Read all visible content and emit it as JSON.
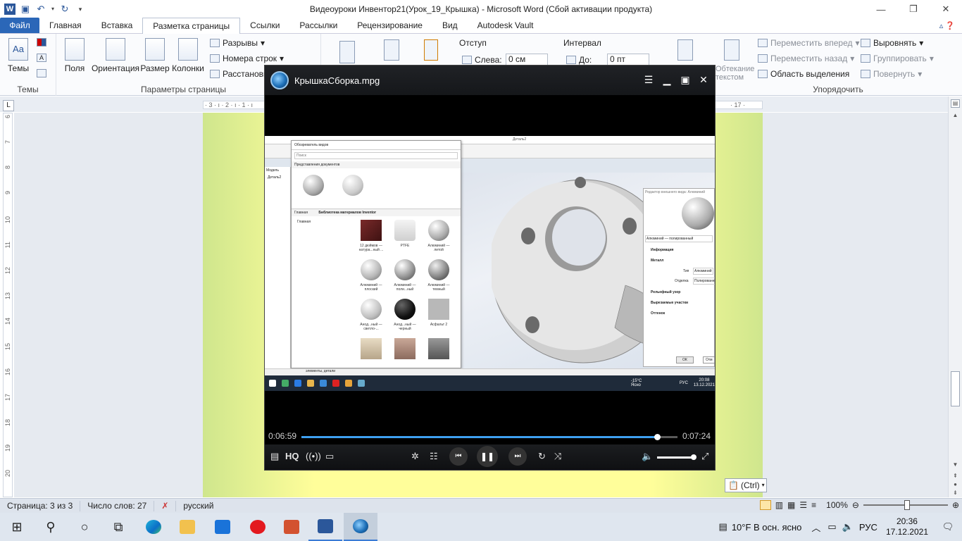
{
  "window": {
    "title": "Видеоуроки Инвентор21(Урок_19_Крышка)  -  Microsoft Word (Сбой активации продукта)"
  },
  "tabs": [
    {
      "label": "Файл"
    },
    {
      "label": "Главная"
    },
    {
      "label": "Вставка"
    },
    {
      "label": "Разметка страницы"
    },
    {
      "label": "Ссылки"
    },
    {
      "label": "Рассылки"
    },
    {
      "label": "Рецензирование"
    },
    {
      "label": "Вид"
    },
    {
      "label": "Autodesk Vault"
    }
  ],
  "ribbon": {
    "themes": {
      "big": "Темы",
      "group": "Темы"
    },
    "page_setup": {
      "fields": "Поля",
      "orientation": "Ориентация",
      "size": "Размер",
      "columns": "Колонки",
      "breaks": "Разрывы",
      "line_numbers": "Номера строк",
      "hyphenation": "Расстановк",
      "group": "Параметры страницы"
    },
    "indent": {
      "label": "Отступ",
      "left_label": "Слева:",
      "left_value": "0 см"
    },
    "spacing": {
      "label": "Интервал",
      "after_label": "До:",
      "after_value": "0 пт"
    },
    "wrap_label_1": "Обтекание",
    "wrap_label_2": "текстом",
    "arrange": {
      "bring_forward": "Переместить вперед",
      "send_backward": "Переместить назад",
      "selection_pane": "Область выделения",
      "align": "Выровнять",
      "group_btn": "Группировать",
      "rotate": "Повернуть",
      "group": "Упорядочить"
    }
  },
  "ruler": {
    "top_left": "· 3 · ı · 2 · ı · 1 · ı",
    "top_right": "· 17 ·",
    "left_numbers": [
      "6",
      "7",
      "8",
      "9",
      "10",
      "11",
      "12",
      "13",
      "14",
      "15",
      "16",
      "17",
      "18",
      "19",
      "20"
    ]
  },
  "player": {
    "title": "КрышкаСборка.mpg",
    "time_current": "0:06:59",
    "time_total": "0:07:24",
    "progress": 0.945,
    "hq_label": "HQ"
  },
  "video_content": {
    "browser_title": "Обозреватель видов",
    "search": "Поиск",
    "doc_views": "Представления документов",
    "main_tab": "Главная",
    "library": "Библиотека материалов Inventor",
    "tree_root": "Главная",
    "materials": [
      "12 дюймов — натура...ный ...",
      "PTFE",
      "Алюминий — литой",
      "Алюминий — плоский",
      "Алюминий — поли...ный",
      "Алюминий — темный",
      "Анод...ный — светло-...",
      "Анод...ный — черный",
      "Асфальт 2"
    ],
    "panel_title": "Редактор внешнего вида: Алюминий",
    "panel_material": "Алюминий — полированный",
    "panel_info": "Информация",
    "panel_metal": "Металл",
    "panel_type_label": "Тип",
    "panel_type_value": "Алюминий",
    "panel_finish_label": "Отделка",
    "panel_finish_value": "Полированный",
    "panel_relief": "Рельефный узор",
    "panel_cutout": "Вырезаемые участки",
    "panel_tint": "Оттенок",
    "panel_ok": "ОК",
    "panel_cancel": "Отм",
    "inner_status": "элементы, детали",
    "inner_weather": "-15°C  Ясно",
    "inner_lang": "РУС",
    "inner_time": "20:08",
    "inner_date": "13.12.2021",
    "model_tab": "Модель",
    "detail_label": "Деталь2"
  },
  "paste_tag": "(Ctrl)",
  "statusbar": {
    "page": "Страница: 3 из 3",
    "words": "Число слов: 27",
    "language": "русский",
    "zoom": "100%"
  },
  "taskbar": {
    "weather": "10°F  В осн. ясно",
    "lang": "РУС",
    "time": "20:36",
    "date": "17.12.2021"
  }
}
